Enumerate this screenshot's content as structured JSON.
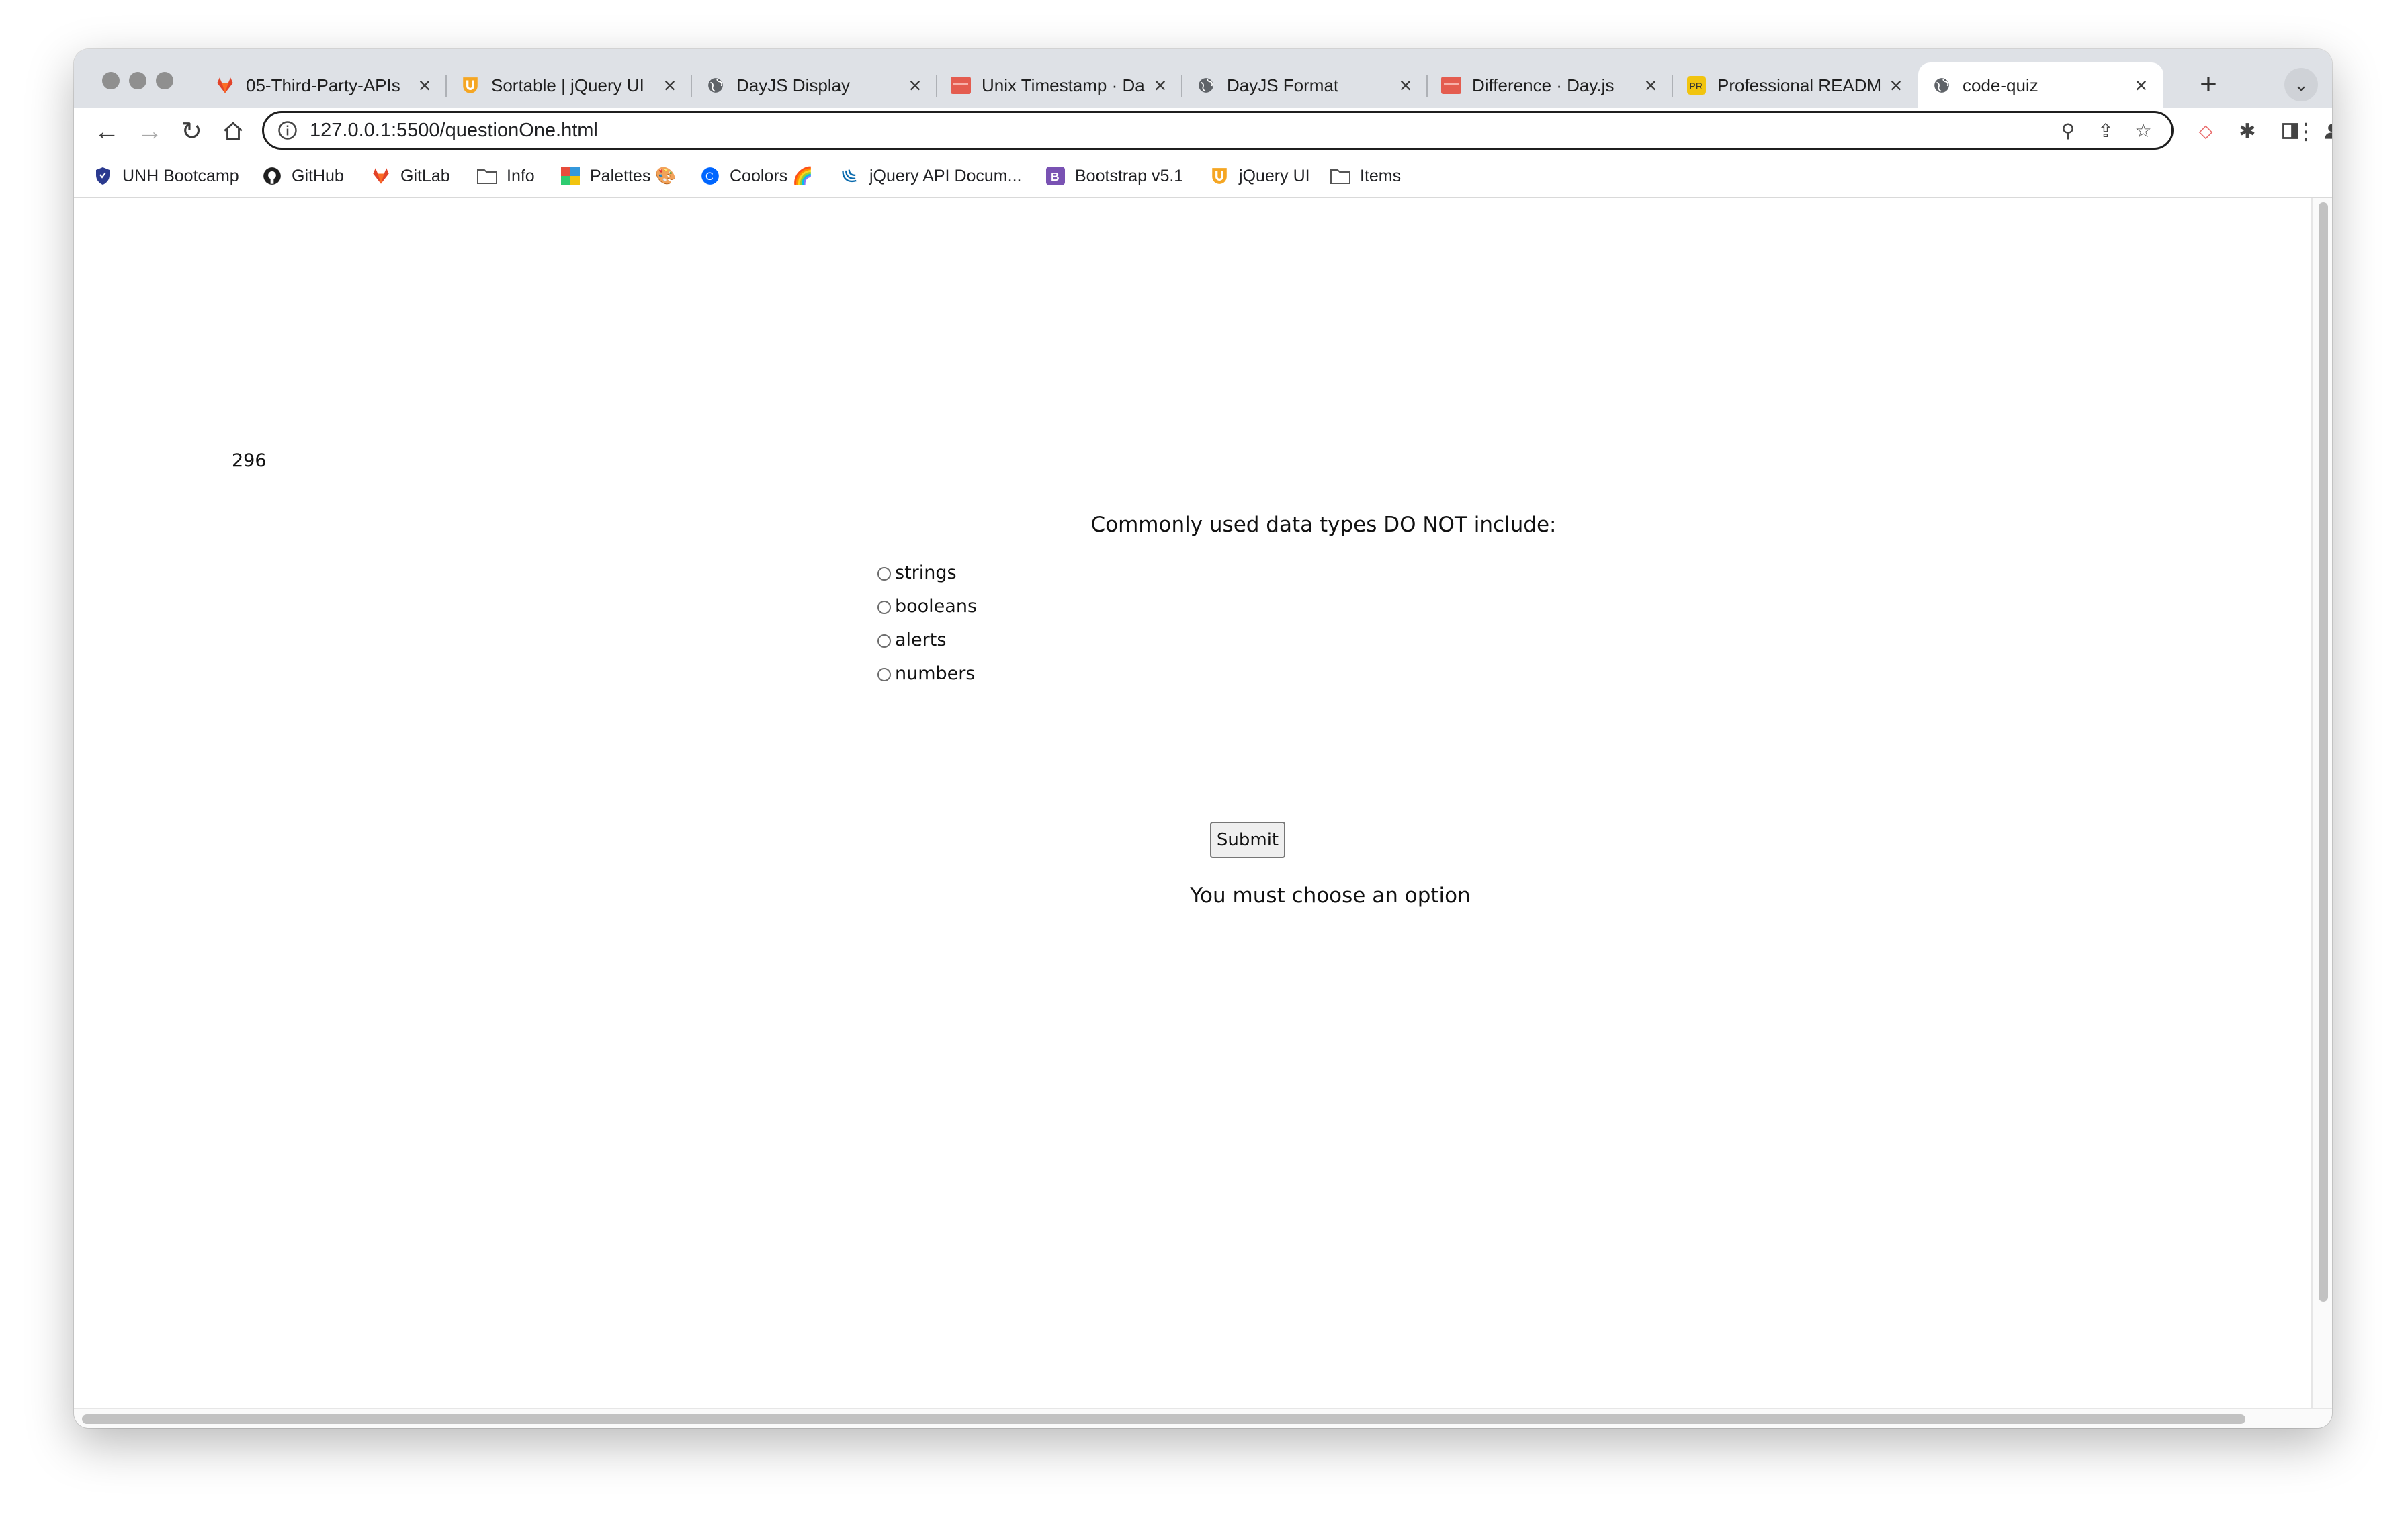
{
  "browser": {
    "tabs": [
      {
        "title": "05-Third-Party-APIs",
        "icon": "gitlab-icon"
      },
      {
        "title": "Sortable | jQuery UI",
        "icon": "jquery-ui-icon"
      },
      {
        "title": "DayJS Display",
        "icon": "globe-icon"
      },
      {
        "title": "Unix Timestamp · Da",
        "icon": "dayjs-icon"
      },
      {
        "title": "DayJS Format",
        "icon": "globe-icon"
      },
      {
        "title": "Difference · Day.js",
        "icon": "dayjs-icon"
      },
      {
        "title": "Professional READM",
        "icon": "readme-icon"
      },
      {
        "title": "code-quiz",
        "icon": "globe-icon",
        "active": true
      }
    ],
    "url": "127.0.0.1:5500/questionOne.html",
    "bookmarks": [
      {
        "label": "UNH Bootcamp",
        "icon": "shield-icon"
      },
      {
        "label": "GitHub",
        "icon": "github-icon"
      },
      {
        "label": "GitLab",
        "icon": "gitlab-icon"
      },
      {
        "label": "Info",
        "icon": "folder-icon"
      },
      {
        "label": "Palettes 🎨",
        "icon": "palette-icon"
      },
      {
        "label": "Coolors 🌈",
        "icon": "coolors-icon"
      },
      {
        "label": "jQuery API Docum...",
        "icon": "jquery-icon"
      },
      {
        "label": "Bootstrap v5.1",
        "icon": "bootstrap-icon"
      },
      {
        "label": "jQuery UI",
        "icon": "jquery-ui-icon"
      },
      {
        "label": "Items",
        "icon": "folder-icon"
      }
    ]
  },
  "quiz": {
    "timer": "296",
    "question": "Commonly used data types DO NOT include:",
    "options": [
      "strings",
      "booleans",
      "alerts",
      "numbers"
    ],
    "submit_label": "Submit",
    "message": "You must choose an option"
  }
}
